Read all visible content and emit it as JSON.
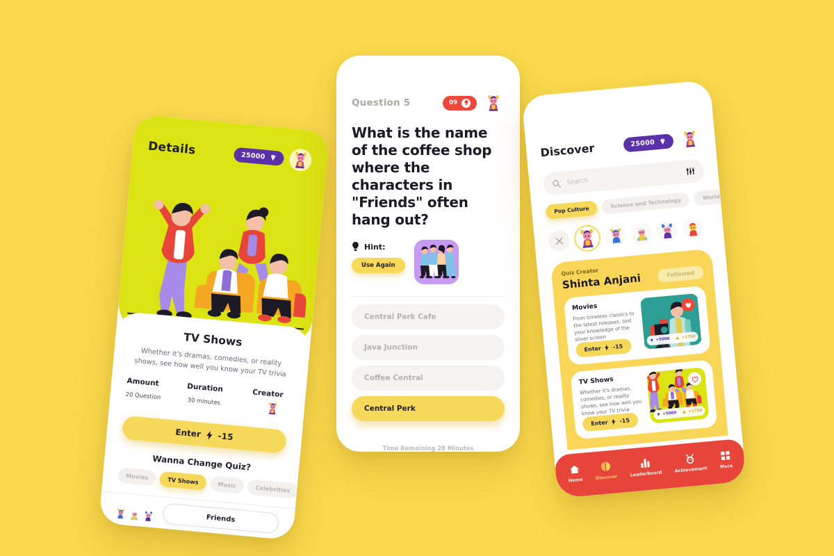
{
  "background_color": "#F9D94E",
  "accent_yellow": "#F6D95B",
  "accent_purple": "#5A31A8",
  "accent_red": "#E8453A",
  "hero_green": "#DBE313",
  "phone1": {
    "screen_name": "quiz-details",
    "header": {
      "title": "Details",
      "coins": "25000",
      "coin_icon": "gem-icon",
      "avatar_icon": "user-avatar-icon"
    },
    "hero_illustration": "friends-watching-tv-illustration",
    "quiz_title": "TV Shows",
    "quiz_description": "Whether it's dramas, comedies, or reality shows, see how well you know your TV trivia",
    "stats": [
      {
        "label": "Amount",
        "value": "20 Question"
      },
      {
        "label": "Duration",
        "value": "30 minutes"
      },
      {
        "label": "Creator",
        "value": ""
      }
    ],
    "enter_button": {
      "label": "Enter",
      "cost": "-15",
      "icon": "bolt-icon"
    },
    "change_quiz_title": "Wanna Change Quiz?",
    "categories": [
      {
        "label": "Movies",
        "selected": false
      },
      {
        "label": "TV Shows",
        "selected": true
      },
      {
        "label": "Music",
        "selected": false
      },
      {
        "label": "Celebrities",
        "selected": false
      }
    ],
    "footer_button": "Friends"
  },
  "phone2": {
    "screen_name": "quiz-question",
    "question_number": "Question 5",
    "timer": {
      "value": "09",
      "icon": "lightbulb-icon"
    },
    "avatar_icon": "user-avatar-icon",
    "question_text": "What is the name of the coffee shop where the characters in \"Friends\" often hang out?",
    "hint": {
      "label": "Hint:",
      "icon": "lightbulb-icon",
      "button_label": "Use Again",
      "image": "friends-group-hint-image"
    },
    "answers": [
      {
        "label": "Central Park Cafe",
        "selected": false
      },
      {
        "label": "Java Junction",
        "selected": false
      },
      {
        "label": "Coffee Central",
        "selected": false
      },
      {
        "label": "Central Perk",
        "selected": true
      }
    ],
    "time_remaining": "Time Remaining 28 Minutes"
  },
  "phone3": {
    "screen_name": "discover",
    "header": {
      "title": "Discover",
      "coins": "25000",
      "coin_icon": "gem-icon",
      "avatar_icon": "user-avatar-icon"
    },
    "search": {
      "placeholder": "Search",
      "value": "",
      "icon": "search-icon",
      "filter_icon": "filter-sliders-icon"
    },
    "category_chips": [
      {
        "label": "Pop Culture",
        "selected": true
      },
      {
        "label": "Science and Technology",
        "selected": false
      },
      {
        "label": "World History",
        "selected": false
      }
    ],
    "avatar_strip": {
      "close_icon": "close-icon",
      "count": 5,
      "active_index": 0
    },
    "creator": {
      "kicker": "Quiz Creator",
      "name": "Shinta Anjani",
      "follow_state": "Followed"
    },
    "quiz_cards": [
      {
        "title": "Movies",
        "description": "From timeless classics to the latest releases, test your knowledge of the silver screen",
        "enter_label": "Enter",
        "enter_cost": "-15",
        "liked": true,
        "gems": "+5000",
        "stars": "+1750",
        "art": "cameraman-illustration",
        "art_bg": "#2C9E93"
      },
      {
        "title": "TV Shows",
        "description": "Whether it's dramas, comedies, or reality shows, see how well you know your TV trivia",
        "enter_label": "Enter",
        "enter_cost": "-15",
        "liked": false,
        "gems": "+5000",
        "stars": "+1750",
        "art": "friends-watching-tv-illustration",
        "art_bg": "#DBE313"
      }
    ],
    "bottom_nav": [
      {
        "label": "Home",
        "icon": "home-icon",
        "active": false
      },
      {
        "label": "Discover",
        "icon": "compass-icon",
        "active": true
      },
      {
        "label": "Leaderboard",
        "icon": "bar-chart-icon",
        "active": false
      },
      {
        "label": "Achievement",
        "icon": "medal-icon",
        "active": false
      },
      {
        "label": "More",
        "icon": "grid-icon",
        "active": false
      }
    ]
  }
}
